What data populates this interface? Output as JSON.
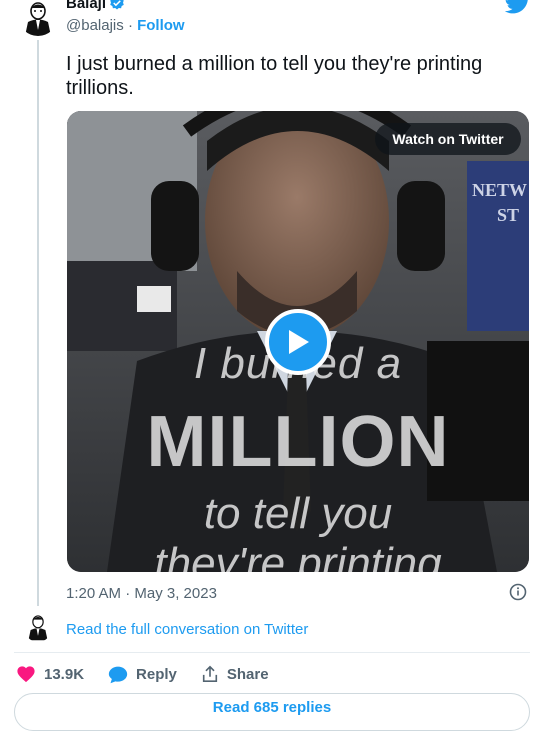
{
  "author": {
    "name": "Balaji",
    "handle": "@balajis",
    "separator": "·",
    "follow_label": "Follow"
  },
  "tweet": {
    "text": "I just burned a million to tell you they're printing trillions.",
    "timestamp": "1:20 AM · May 3, 2023"
  },
  "video": {
    "watch_label": "Watch on Twitter",
    "overlay": {
      "line1": "I burned a",
      "line2": "MILLION",
      "line3": "to tell you",
      "line4": "they're printing"
    },
    "background_sign": "NETW ST"
  },
  "conversation_link": "Read the full conversation on Twitter",
  "actions": {
    "likes": "13.9K",
    "reply_label": "Reply",
    "share_label": "Share"
  },
  "replies_button": "Read 685 replies",
  "colors": {
    "accent": "#1d9bf0",
    "like": "#f91880",
    "text": "#0f1419",
    "muted": "#536471"
  },
  "icons": [
    "verified-icon",
    "twitter-bird-icon",
    "play-icon",
    "info-icon",
    "heart-icon",
    "reply-icon",
    "share-icon"
  ]
}
